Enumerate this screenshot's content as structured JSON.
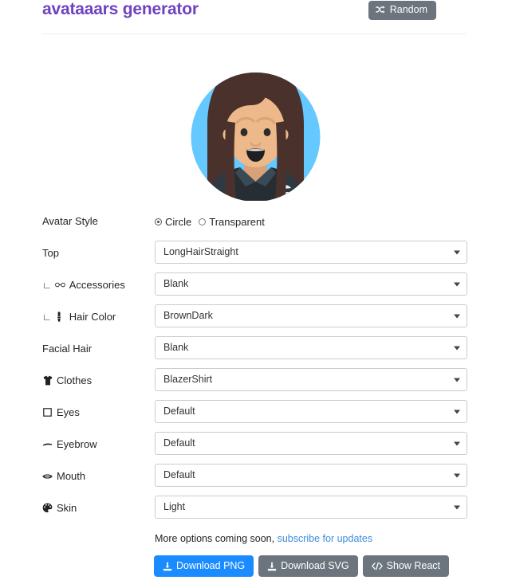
{
  "header": {
    "title": "avataaars generator",
    "random_button": {
      "label": "Random",
      "icon": "shuffle-icon"
    }
  },
  "avatar": {
    "style": "Circle",
    "background_color": "#65C9FF",
    "skin_color": "#EDB98A",
    "hair_color": "#4A312C",
    "clothes_color": "#262E33",
    "clothes_accent": "#3A4B55"
  },
  "avatar_style": {
    "label": "Avatar Style",
    "options": [
      {
        "label": "Circle",
        "selected": true
      },
      {
        "label": "Transparent",
        "selected": false
      }
    ]
  },
  "fields": [
    {
      "label": "Top",
      "icon": "",
      "indent": false,
      "value": "LongHairStraight",
      "name": "top"
    },
    {
      "label": "Accessories",
      "icon": "glasses-icon",
      "indent": true,
      "value": "Blank",
      "name": "accessories"
    },
    {
      "label": "Hair Color",
      "icon": "paintbrush-icon",
      "indent": true,
      "value": "BrownDark",
      "name": "hair-color"
    },
    {
      "label": "Facial Hair",
      "icon": "",
      "indent": false,
      "value": "Blank",
      "name": "facial-hair"
    },
    {
      "label": "Clothes",
      "icon": "tshirt-icon",
      "indent": false,
      "value": "BlazerShirt",
      "name": "clothes"
    },
    {
      "label": "Eyes",
      "icon": "eye-icon",
      "indent": false,
      "value": "Default",
      "name": "eyes"
    },
    {
      "label": "Eyebrow",
      "icon": "eyebrow-icon",
      "indent": false,
      "value": "Default",
      "name": "eyebrow"
    },
    {
      "label": "Mouth",
      "icon": "mouth-icon",
      "indent": false,
      "value": "Default",
      "name": "mouth"
    },
    {
      "label": "Skin",
      "icon": "palette-icon",
      "indent": false,
      "value": "Light",
      "name": "skin"
    }
  ],
  "footer": {
    "note_text": "More options coming soon,",
    "link_text": "subscribe for updates",
    "buttons": [
      {
        "label": "Download PNG",
        "icon": "download-icon",
        "style": "primary"
      },
      {
        "label": "Download SVG",
        "icon": "download-icon",
        "style": "secondary"
      },
      {
        "label": "Show React",
        "icon": "code-icon",
        "style": "secondary"
      }
    ]
  },
  "colors": {
    "title": "#6f42c1",
    "primary": "#1a8cff",
    "secondary": "#6c757d",
    "link": "#3c8dde"
  }
}
